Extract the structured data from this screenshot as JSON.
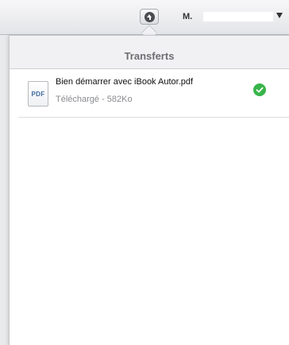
{
  "toolbar": {
    "upload_icon": "upload-arrow-icon",
    "user_label": "M.",
    "dropdown_icon": "triangle-down-icon"
  },
  "popover": {
    "title": "Transferts"
  },
  "transfers": [
    {
      "file_type": "PDF",
      "file_name": "Bien démarrer avec iBook Autor.pdf",
      "status": "Téléchargé - 582Ko",
      "status_icon": "checkmark-circle-icon",
      "status_color": "#38b449"
    }
  ]
}
